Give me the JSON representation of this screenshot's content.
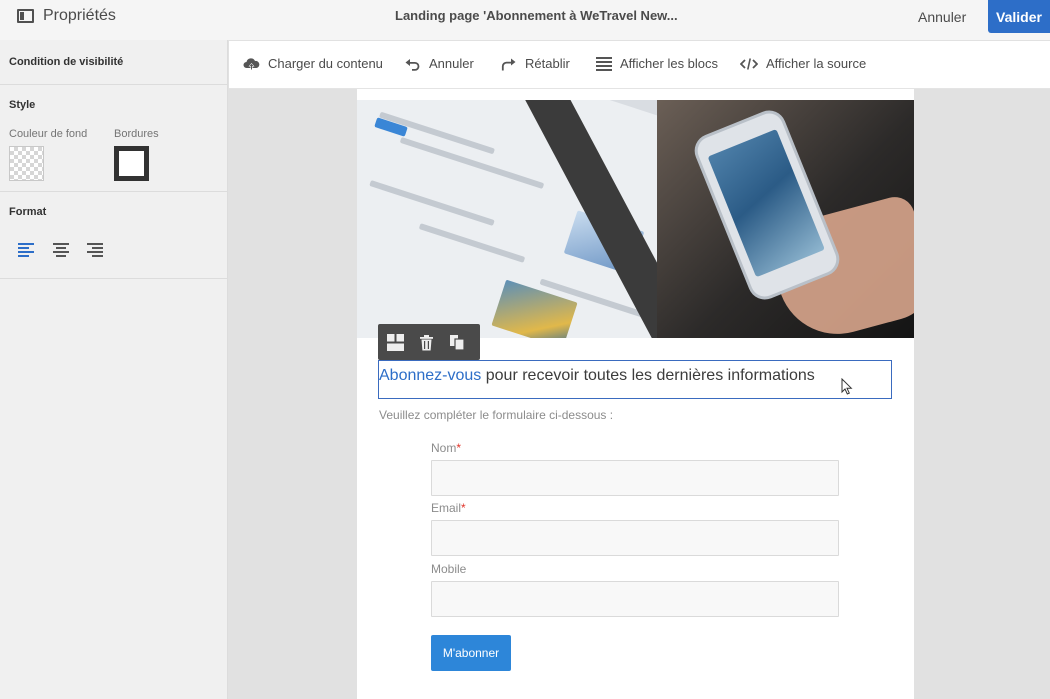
{
  "header": {
    "panel_title": "Propriétés",
    "document_title": "Landing page 'Abonnement à WeTravel New...",
    "cancel_label": "Annuler",
    "validate_label": "Valider"
  },
  "properties": {
    "visibility_heading": "Condition de visibilité",
    "style_heading": "Style",
    "background_color_label": "Couleur de fond",
    "borders_label": "Bordures",
    "format_heading": "Format",
    "alignment_selected": "left"
  },
  "toolbar": {
    "upload_label": "Charger du contenu",
    "undo_label": "Annuler",
    "redo_label": "Rétablir",
    "show_blocks_label": "Afficher les blocs",
    "show_source_label": "Afficher la source"
  },
  "content": {
    "headline_accent": "Abonnez-vous",
    "headline_rest": " pour recevoir toutes les dernières informations",
    "subtitle": "Veuillez compléter le formulaire ci-dessous :",
    "fields": [
      {
        "label": "Nom",
        "required": "*",
        "value": ""
      },
      {
        "label": "Email",
        "required": "*",
        "value": ""
      },
      {
        "label": "Mobile",
        "required": "",
        "value": ""
      }
    ],
    "submit_label": "M'abonner"
  },
  "colors": {
    "accent": "#2d6ec8",
    "button": "#2d86d9",
    "required": "#e0352b"
  }
}
